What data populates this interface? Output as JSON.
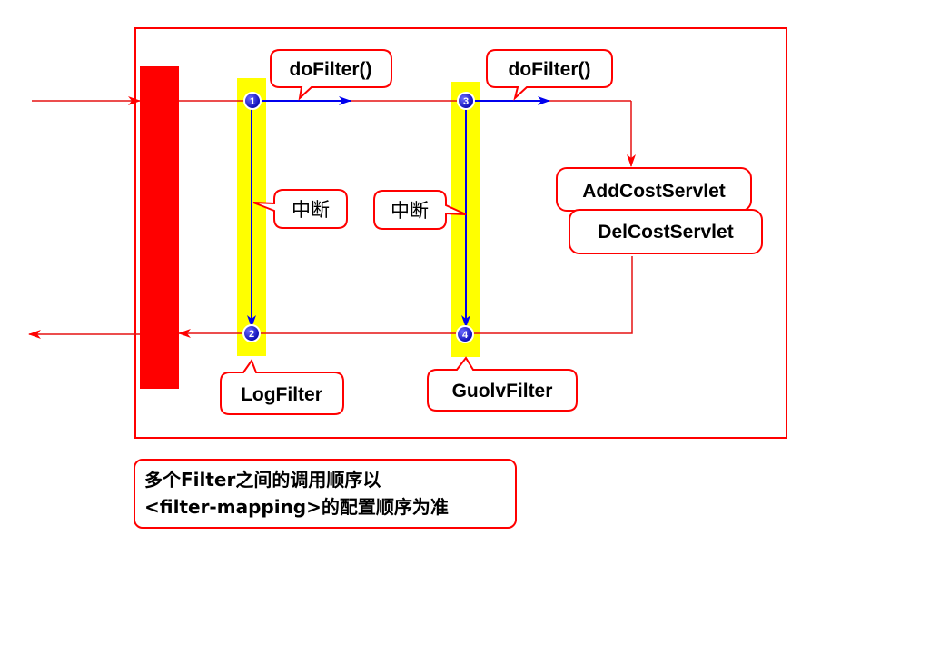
{
  "callouts": {
    "dofilter_1": "doFilter()",
    "dofilter_2": "doFilter()",
    "interrupt_1": "中断",
    "interrupt_2": "中断",
    "servlet_add": "AddCostServlet",
    "servlet_del": "DelCostServlet",
    "filter_log": "LogFilter",
    "filter_guolv": "GuolvFilter"
  },
  "markers": [
    "1",
    "2",
    "3",
    "4"
  ],
  "note": {
    "line1": "多个Filter之间的调用顺序以",
    "line2": "<filter-mapping>的配置顺序为准"
  },
  "colors": {
    "frame": "#ff0000",
    "request_line": "#e51212",
    "filter_bar": "#ffff00",
    "flow_arrow": "#0000ee",
    "marker_fill": "#1010cc"
  }
}
